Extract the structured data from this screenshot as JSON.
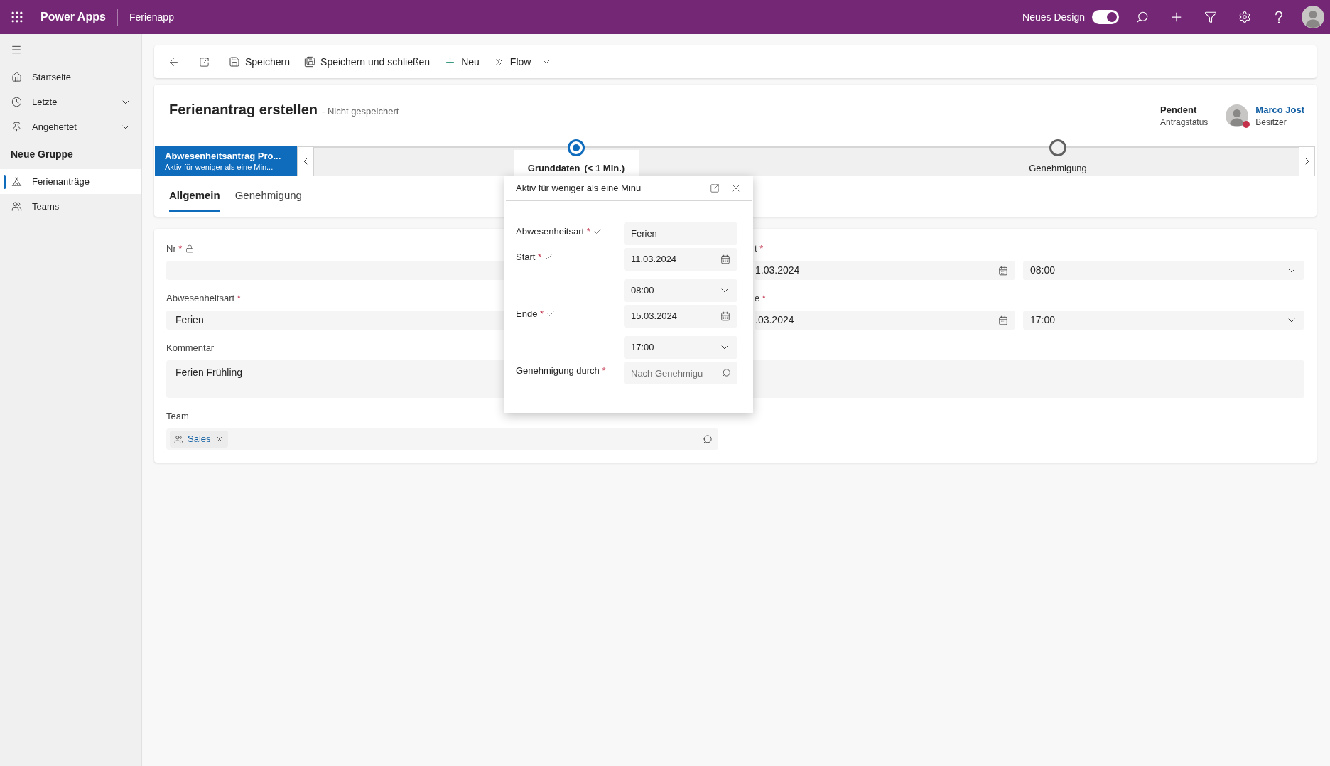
{
  "app_bar": {
    "app_name": "Power Apps",
    "app_title": "Ferienapp",
    "design_toggle": {
      "label": "Neues Design",
      "on": true
    }
  },
  "sidebar": {
    "items": [
      {
        "kind": "home",
        "label": "Startseite",
        "selected": false
      },
      {
        "kind": "recent",
        "label": "Letzte",
        "selected": false,
        "expanded": false
      },
      {
        "kind": "pinned",
        "label": "Angeheftet",
        "selected": false,
        "expanded": false
      }
    ],
    "groups": [
      {
        "title": "Neue Gruppe",
        "items": [
          {
            "kind": "entity",
            "label": "Ferienanträge",
            "selected": true
          },
          {
            "kind": "team",
            "label": "Teams",
            "selected": false
          }
        ]
      }
    ]
  },
  "command_bar": {
    "buttons": [
      {
        "kind": "save",
        "label": "Speichern"
      },
      {
        "kind": "save_close",
        "label": "Speichern und schließen"
      },
      {
        "kind": "new",
        "label": "Neu"
      },
      {
        "kind": "flow",
        "label": "Flow"
      }
    ]
  },
  "header": {
    "title": "Ferienantrag erstellen",
    "subtitle": "- Nicht gespeichert",
    "status": {
      "value": "Pendent",
      "label": "Antragstatus"
    },
    "owner": {
      "name": "Marco Jost",
      "role": "Besitzer",
      "busy": true
    }
  },
  "process": {
    "name": "Abwesenheitsantrag Pro...",
    "active_time": "Aktiv für weniger als eine Min...",
    "stages": [
      {
        "label": "Grunddaten",
        "duration": "(< 1 Min.)",
        "selected": true
      },
      {
        "label": "Genehmigung",
        "selected": false
      }
    ]
  },
  "stage_flyout": {
    "title": "Aktiv für weniger als eine Minu",
    "fields": [
      {
        "label": "Abwesenheitsart",
        "required_mark": "*",
        "done": true,
        "inputs": [
          {
            "kind": "text",
            "value": "Ferien"
          }
        ]
      },
      {
        "label": "Start",
        "required_mark": "*",
        "done": true,
        "inputs": [
          {
            "kind": "date",
            "value": "11.03.2024"
          },
          {
            "kind": "time",
            "value": "08:00"
          }
        ]
      },
      {
        "label": "Ende",
        "required_mark": "*",
        "done": true,
        "inputs": [
          {
            "kind": "date",
            "value": "15.03.2024"
          },
          {
            "kind": "time",
            "value": "17:00"
          }
        ]
      },
      {
        "label": "Genehmigung durch",
        "required_mark": "*",
        "done": false,
        "inputs": [
          {
            "kind": "lookup",
            "placeholder": "Nach Genehmigu"
          }
        ]
      }
    ]
  },
  "tabs": [
    {
      "label": "Allgemein",
      "selected": true
    },
    {
      "label": "Genehmigung",
      "selected": false
    }
  ],
  "form": {
    "fields": [
      {
        "kind": "text",
        "label": "Nr",
        "required_mark": "*",
        "locked": true
      },
      {
        "kind": "datetime",
        "label": "t",
        "required_mark": "*",
        "locked": false,
        "date": "1.03.2024",
        "time": "08:00"
      },
      {
        "kind": "text",
        "label": "Abwesenheitsart",
        "required_mark": "*",
        "locked": false,
        "value": "Ferien"
      },
      {
        "kind": "datetime",
        "label": "e",
        "required_mark": "*",
        "locked": false,
        "date": ".03.2024",
        "time": "17:00"
      },
      {
        "kind": "multiline",
        "label": "Kommentar",
        "locked": false,
        "value": "Ferien Frühling"
      },
      {
        "kind": "lookup",
        "label": "Team",
        "locked": false,
        "tags": [
          {
            "label": "Sales"
          }
        ]
      }
    ]
  }
}
